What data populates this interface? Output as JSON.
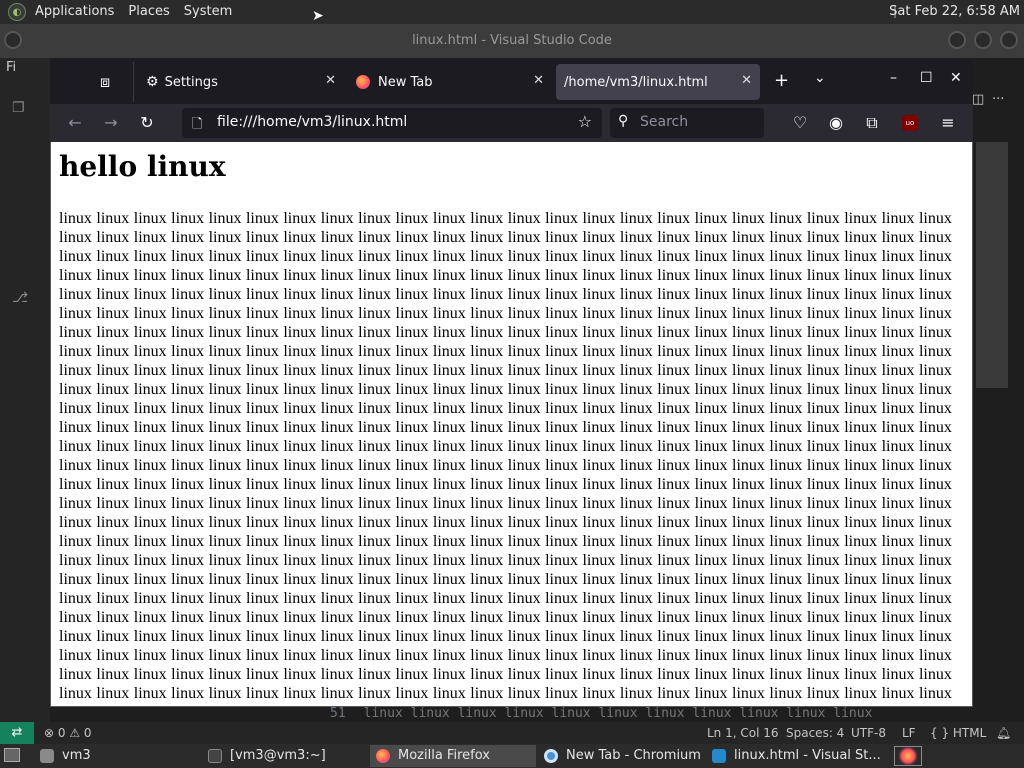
{
  "top_panel": {
    "menus": [
      "Applications",
      "Places",
      "System"
    ],
    "clock": "Sat Feb 22,  6:58 AM"
  },
  "vscode": {
    "title": "linux.html - Visual Studio Code",
    "menu_file": "Fi",
    "tab_more": "···",
    "editor_line": "linux linux linux linux linux linux linux linux linux linux linux ",
    "status": {
      "remote_icon": "remote-icon",
      "problems": "⊗ 0 ⚠ 0",
      "position": "Ln 1, Col 16",
      "spaces": "Spaces: 4",
      "encoding": "UTF-8",
      "eol": "LF",
      "language": "{ } HTML"
    }
  },
  "firefox": {
    "tabs": [
      {
        "label": "Settings",
        "icon": "gear-icon"
      },
      {
        "label": "New Tab",
        "icon": "firefox-icon"
      },
      {
        "label": "/home/vm3/linux.html",
        "icon": ""
      }
    ],
    "url": "file:///home/vm3/linux.html",
    "search_placeholder": "Search",
    "extension_badge": "uo",
    "page": {
      "heading": "hello linux",
      "word": "linux",
      "rows": 26,
      "words_per_row": 24
    }
  },
  "taskbar": {
    "items": [
      {
        "label": "vm3",
        "icon": "folder-icon"
      },
      {
        "label": "[vm3@vm3:~]",
        "icon": "terminal-icon"
      },
      {
        "label": "Mozilla Firefox",
        "icon": "firefox-icon",
        "active": true
      },
      {
        "label": "New Tab - Chromium",
        "icon": "chromium-icon"
      },
      {
        "label": "linux.html - Visual St...",
        "icon": "vscode-icon"
      }
    ]
  },
  "colors": {
    "firefox_dark": "#1c1b22",
    "firefox_toolbar": "#2b2a33",
    "active_tab": "#42414d",
    "vscode_remote": "#16825d"
  }
}
